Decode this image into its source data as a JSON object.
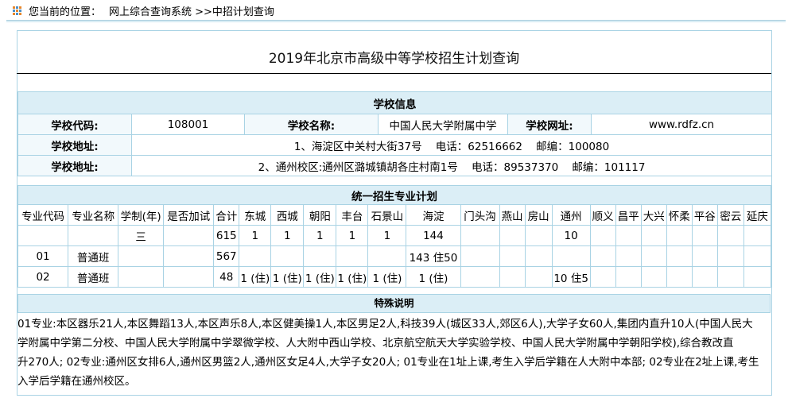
{
  "breadcrumb": {
    "prefix": "您当前的位置：",
    "text": "网上综合查询系统 >>中招计划查询"
  },
  "page_title": "2019年北京市高级中等学校招生计划查询",
  "school_info": {
    "header": "学校信息",
    "code_label": "学校代码:",
    "code": "108001",
    "name_label": "学校名称:",
    "name": "中国人民大学附属中学",
    "site_label": "学校网址:",
    "site": "www.rdfz.cn",
    "addr_label_1": "学校地址:",
    "addr_1": "1、海淀区中关村大街37号    电话：62516662    邮编：100080",
    "addr_label_2": "学校地址:",
    "addr_2": "2、通州校区:通州区潞城镇胡各庄村南1号    电话：89537370    邮编：101117"
  },
  "plan": {
    "header": "统一招生专业计划",
    "columns": [
      "专业代码",
      "专业名称",
      "学制(年)",
      "是否加试",
      "合计",
      "东城",
      "西城",
      "朝阳",
      "丰台",
      "石景山",
      "海淀",
      "门头沟",
      "燕山",
      "房山",
      "通州",
      "顺义",
      "昌平",
      "大兴",
      "怀柔",
      "平谷",
      "密云",
      "延庆"
    ],
    "rows": [
      [
        "",
        "",
        "三",
        "",
        "615",
        "1",
        "1",
        "1",
        "1",
        "1",
        "144",
        "",
        "",
        "",
        "10",
        "",
        "",
        "",
        "",
        "",
        "",
        ""
      ],
      [
        "01",
        "普通班",
        "",
        "",
        "567",
        "",
        "",
        "",
        "",
        "",
        "143 住50",
        "",
        "",
        "",
        "",
        "",
        "",
        "",
        "",
        "",
        "",
        ""
      ],
      [
        "02",
        "普通班",
        "",
        "",
        "48",
        "1 (住)",
        "1 (住)",
        "1 (住)",
        "1 (住)",
        "1 (住)",
        "1 (住)",
        "",
        "",
        "",
        "10 住5",
        "",
        "",
        "",
        "",
        "",
        "",
        ""
      ]
    ]
  },
  "notes": {
    "header": "特殊说明",
    "lines": [
      "01专业:本区器乐21人,本区舞蹈13人,本区声乐8人,本区健美操1人,本区男足2人,科技39人(城区33人,郊区6人),大学子女60人,集团内直升10人(中国人民大",
      "学附属中学第二分校、中国人民大学附属中学翠微学校、人大附中西山学校、北京航空航天大学实验学校、中国人民大学附属中学朝阳学校),综合教改直",
      "升270人; 02专业:通州区女排6人,通州区男篮2人,通州区女足4人,大学子女20人; 01专业在1址上课,考生入学后学籍在人大附中本部; 02专业在2址上课,考生",
      "入学后学籍在通州校区。"
    ]
  },
  "colors": {
    "border": "#a9d3e4",
    "header_bg": "#dbeef6",
    "icon_orange": "#e8862a",
    "icon_blue": "#4a8fc9"
  }
}
